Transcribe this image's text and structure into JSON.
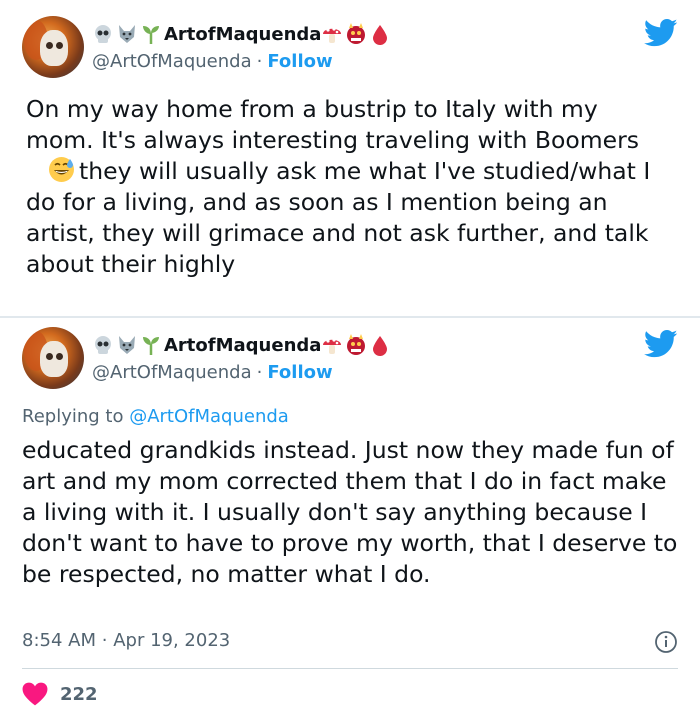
{
  "colors": {
    "link": "#1d9bf0",
    "secondary_text": "#536471",
    "primary_text": "#0f1419",
    "heart": "#f91880",
    "divider": "#e1e8ed"
  },
  "tweets": [
    {
      "display_name": "ArtofMaquenda",
      "name_emojis_before": [
        "skull-emoji",
        "wolf-emoji",
        "seedling-emoji"
      ],
      "name_emojis_after": [
        "mushroom-emoji",
        "ogre-emoji",
        "drop-of-blood-emoji"
      ],
      "handle": "@ArtOfMaquenda",
      "separator": "·",
      "follow_label": "Follow",
      "platform_icon": "twitter-bird-icon",
      "text_before_emoji": "On my way home from a bustrip to Italy with my mom. It's always interesting traveling with Boomers",
      "inline_emoji": "grinning-face-with-sweat-emoji",
      "text_after_emoji": "they will usually ask me what I've studied/what I do for a living, and as soon as I mention being an artist, they will grimace and not ask further, and talk about their highly"
    },
    {
      "display_name": "ArtofMaquenda",
      "name_emojis_before": [
        "skull-emoji",
        "wolf-emoji",
        "seedling-emoji"
      ],
      "name_emojis_after": [
        "mushroom-emoji",
        "ogre-emoji",
        "drop-of-blood-emoji"
      ],
      "handle": "@ArtOfMaquenda",
      "separator": "·",
      "follow_label": "Follow",
      "platform_icon": "twitter-bird-icon",
      "replying_prefix": "Replying to",
      "replying_to": "@ArtOfMaquenda",
      "text": "educated grandkids instead. Just now they made fun of art and my mom corrected them that I do in fact make a living with it. I usually don't say anything because I don't want to have to prove my worth, that I deserve to be respected, no matter what I do.",
      "time": "8:54 AM",
      "time_separator": "·",
      "date": "Apr 19, 2023",
      "info_icon": "info-icon",
      "like_icon": "heart-icon",
      "like_count": "222"
    }
  ]
}
